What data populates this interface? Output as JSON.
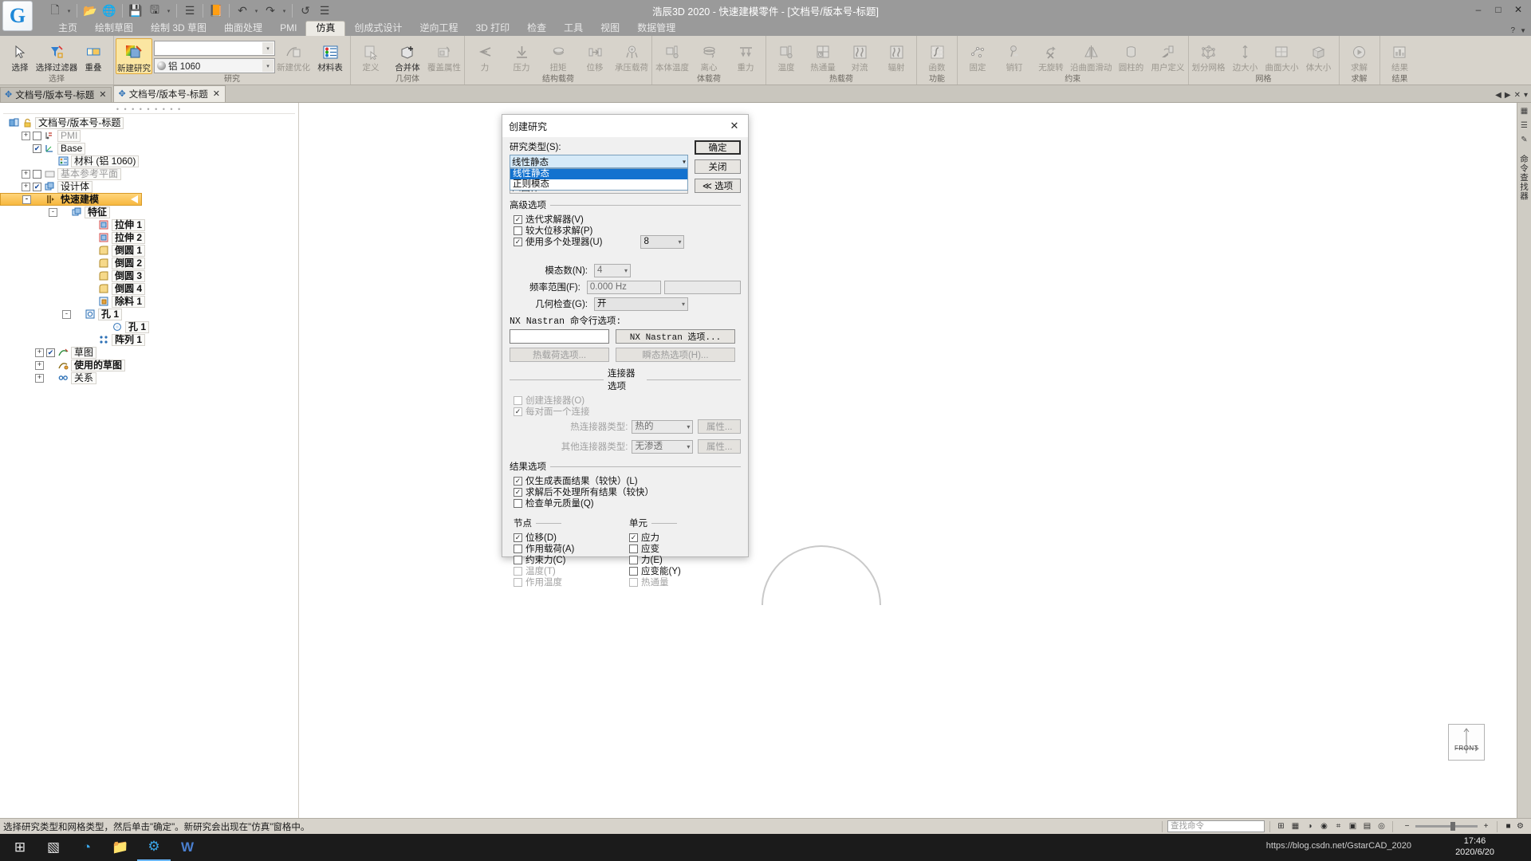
{
  "window": {
    "title": "浩辰3D 2020 - 快速建模零件 - [文档号/版本号-标题]",
    "logo_text": "G",
    "minimize": "–",
    "maximize": "□",
    "close": "✕",
    "help": "?",
    "ribbon_collapse": "▼"
  },
  "quick_access": [
    {
      "name": "new-file-icon",
      "glyph": "🗋"
    },
    {
      "name": "new-dropdown-icon",
      "glyph": "▾"
    },
    {
      "name": "open-icon",
      "glyph": "📂"
    },
    {
      "name": "web-icon",
      "glyph": "🌐"
    },
    {
      "name": "save-icon",
      "glyph": "💾"
    },
    {
      "name": "save-as-icon",
      "glyph": "🖫"
    },
    {
      "name": "save-dropdown-icon",
      "glyph": "▾"
    },
    {
      "name": "properties-icon",
      "glyph": "☰"
    },
    {
      "name": "print-icon",
      "glyph": "📙"
    },
    {
      "name": "undo-icon",
      "glyph": "↶"
    },
    {
      "name": "undo-dropdown-icon",
      "glyph": "▾"
    },
    {
      "name": "redo-icon",
      "glyph": "↷"
    },
    {
      "name": "redo-dropdown-icon",
      "glyph": "▾"
    },
    {
      "name": "repeat-icon",
      "glyph": "↺"
    },
    {
      "name": "customize-icon",
      "glyph": "☰"
    }
  ],
  "tabs": [
    {
      "label": "主页",
      "active": false
    },
    {
      "label": "绘制草图",
      "active": false
    },
    {
      "label": "绘制 3D 草图",
      "active": false
    },
    {
      "label": "曲面处理",
      "active": false
    },
    {
      "label": "PMI",
      "active": false
    },
    {
      "label": "仿真",
      "active": true
    },
    {
      "label": "创成式设计",
      "active": false
    },
    {
      "label": "逆向工程",
      "active": false
    },
    {
      "label": "3D 打印",
      "active": false
    },
    {
      "label": "检查",
      "active": false
    },
    {
      "label": "工具",
      "active": false
    },
    {
      "label": "视图",
      "active": false
    },
    {
      "label": "数据管理",
      "active": false
    }
  ],
  "ribbon_groups": [
    {
      "name": "选择",
      "items": [
        {
          "label": "选择",
          "glyph": "↖",
          "dim": false,
          "highlight": false
        },
        {
          "label": "选择过滤器",
          "glyph": "▽",
          "dim": false,
          "highlight": false
        },
        {
          "label": "重叠",
          "glyph": "▣",
          "dim": false,
          "highlight": false
        }
      ]
    },
    {
      "name": "研究",
      "items": [
        {
          "label": "新建研究",
          "glyph": "🎨",
          "dim": false,
          "highlight": true
        },
        {
          "label": "新建优化",
          "glyph": "🖼",
          "dim": true,
          "highlight": false
        },
        {
          "label": "材料表",
          "glyph": "☰",
          "dim": false,
          "highlight": false
        }
      ],
      "combo_empty_value": "",
      "combo_material_value": "铝 1060"
    },
    {
      "name": "几何体",
      "items": [
        {
          "label": "定义",
          "glyph": "▭",
          "dim": true,
          "highlight": false
        },
        {
          "label": "合并体",
          "glyph": "❐",
          "dim": false,
          "highlight": false
        },
        {
          "label": "覆盖属性",
          "glyph": "✋",
          "dim": true,
          "highlight": false
        }
      ]
    },
    {
      "name": "结构载荷",
      "items": [
        {
          "label": "力",
          "glyph": "⇐",
          "dim": true,
          "highlight": false
        },
        {
          "label": "压力",
          "glyph": "⬇",
          "dim": true,
          "highlight": false
        },
        {
          "label": "扭矩",
          "glyph": "↺",
          "dim": true,
          "highlight": false
        },
        {
          "label": "位移",
          "glyph": "↦",
          "dim": true,
          "highlight": false
        },
        {
          "label": "承压载荷",
          "glyph": "❂",
          "dim": true,
          "highlight": false
        }
      ]
    },
    {
      "name": "体载荷",
      "items": [
        {
          "label": "本体温度",
          "glyph": "🌡",
          "dim": true,
          "highlight": false
        },
        {
          "label": "离心",
          "glyph": "⟳",
          "dim": true,
          "highlight": false
        },
        {
          "label": "重力",
          "glyph": "⇊",
          "dim": true,
          "highlight": false
        }
      ]
    },
    {
      "name": "热载荷",
      "items": [
        {
          "label": "温度",
          "glyph": "🌡",
          "dim": true,
          "highlight": false
        },
        {
          "label": "热通量",
          "glyph": "⊞",
          "dim": true,
          "highlight": false
        },
        {
          "label": "对流",
          "glyph": "≈",
          "dim": true,
          "highlight": false
        },
        {
          "label": "辐射",
          "glyph": "✳",
          "dim": true,
          "highlight": false
        }
      ]
    },
    {
      "name": "功能",
      "items": [
        {
          "label": "函数",
          "glyph": "ƒ",
          "dim": true,
          "highlight": false
        }
      ]
    },
    {
      "name": "约束",
      "items": [
        {
          "label": "固定",
          "glyph": "✦",
          "dim": true,
          "highlight": false
        },
        {
          "label": "销钉",
          "glyph": "📍",
          "dim": true,
          "highlight": false
        },
        {
          "label": "无旋转",
          "glyph": "↷",
          "dim": true,
          "highlight": false
        },
        {
          "label": "沿曲面滑动",
          "glyph": "△",
          "dim": true,
          "highlight": false
        },
        {
          "label": "圆柱的",
          "glyph": "▭",
          "dim": true,
          "highlight": false
        },
        {
          "label": "用户定义",
          "glyph": "☚",
          "dim": true,
          "highlight": false
        }
      ]
    },
    {
      "name": "网格",
      "items": [
        {
          "label": "划分网格",
          "glyph": "⌗",
          "dim": true,
          "highlight": false
        },
        {
          "label": "边大小",
          "glyph": "↕",
          "dim": true,
          "highlight": false
        },
        {
          "label": "曲面大小",
          "glyph": "▧",
          "dim": true,
          "highlight": false
        },
        {
          "label": "体大小",
          "glyph": "▦",
          "dim": true,
          "highlight": false
        }
      ]
    },
    {
      "name": "求解",
      "items": [
        {
          "label": "求解",
          "glyph": "▶",
          "dim": true,
          "highlight": false
        }
      ]
    },
    {
      "name": "结果",
      "items": [
        {
          "label": "结果",
          "glyph": "📊",
          "dim": true,
          "highlight": false
        }
      ]
    }
  ],
  "doc_tabs": [
    {
      "label": "文档号/版本号-标题",
      "active": false,
      "close": "✕"
    },
    {
      "label": "文档号/版本号-标题",
      "active": true,
      "close": "✕"
    }
  ],
  "doc_tabs_right": [
    "◀",
    "▶",
    "✕",
    "▾"
  ],
  "tree": {
    "root": "文档号/版本号-标题",
    "nodes": [
      {
        "label": "PMI",
        "indent": 1,
        "expander": "+",
        "checkbox": "unchecked",
        "icon": "pmi-icon",
        "dim": true,
        "boxed": true,
        "bold": false
      },
      {
        "label": "Base",
        "indent": 1,
        "expander": "none",
        "checkbox": "checked",
        "icon": "coordinate-system-icon",
        "dim": false,
        "boxed": true,
        "bold": false
      },
      {
        "label": "材料 (铝 1060)",
        "indent": 2,
        "expander": "none",
        "checkbox": "none",
        "icon": "material-icon",
        "dim": false,
        "boxed": true,
        "bold": false
      },
      {
        "label": "基本参考平面",
        "indent": 1,
        "expander": "+",
        "checkbox": "unchecked",
        "icon": "plane-icon",
        "dim": true,
        "boxed": true,
        "bold": false
      },
      {
        "label": "设计体",
        "indent": 1,
        "expander": "+",
        "checkbox": "checked",
        "icon": "body-icon",
        "dim": false,
        "boxed": true,
        "bold": false
      },
      {
        "label": "快速建模",
        "indent": 1,
        "expander": "-",
        "checkbox": "none",
        "icon": "quickmodel-icon",
        "dim": false,
        "boxed": false,
        "bold": true,
        "selected": true
      },
      {
        "label": "特征",
        "indent": 3,
        "expander": "-",
        "checkbox": "none",
        "icon": "feature-icon",
        "dim": false,
        "boxed": true,
        "bold": true
      },
      {
        "label": "拉伸 1",
        "indent": 5,
        "expander": "none",
        "checkbox": "none",
        "icon": "extrude-icon",
        "dim": false,
        "boxed": true,
        "bold": true
      },
      {
        "label": "拉伸 2",
        "indent": 5,
        "expander": "none",
        "checkbox": "none",
        "icon": "extrude-icon",
        "dim": false,
        "boxed": true,
        "bold": true
      },
      {
        "label": "倒圆 1",
        "indent": 5,
        "expander": "none",
        "checkbox": "none",
        "icon": "fillet-icon",
        "dim": false,
        "boxed": true,
        "bold": true
      },
      {
        "label": "倒圆 2",
        "indent": 5,
        "expander": "none",
        "checkbox": "none",
        "icon": "fillet-icon",
        "dim": false,
        "boxed": true,
        "bold": true
      },
      {
        "label": "倒圆 3",
        "indent": 5,
        "expander": "none",
        "checkbox": "none",
        "icon": "fillet-icon",
        "dim": false,
        "boxed": true,
        "bold": true
      },
      {
        "label": "倒圆 4",
        "indent": 5,
        "expander": "none",
        "checkbox": "none",
        "icon": "fillet-icon",
        "dim": false,
        "boxed": true,
        "bold": true
      },
      {
        "label": "除料 1",
        "indent": 5,
        "expander": "none",
        "checkbox": "none",
        "icon": "cut-icon",
        "dim": false,
        "boxed": true,
        "bold": true
      },
      {
        "label": "孔 1",
        "indent": 4,
        "expander": "-",
        "checkbox": "none",
        "icon": "hole-group-icon",
        "dim": false,
        "boxed": true,
        "bold": true
      },
      {
        "label": "孔 1",
        "indent": 6,
        "expander": "none",
        "checkbox": "none",
        "icon": "hole-icon",
        "dim": false,
        "boxed": true,
        "bold": true
      },
      {
        "label": "阵列 1",
        "indent": 5,
        "expander": "none",
        "checkbox": "none",
        "icon": "pattern-icon",
        "dim": false,
        "boxed": true,
        "bold": true
      },
      {
        "label": "草图",
        "indent": 2,
        "expander": "+",
        "checkbox": "checked",
        "icon": "sketch-icon",
        "dim": false,
        "boxed": true,
        "bold": false
      },
      {
        "label": "使用的草图",
        "indent": 2,
        "expander": "+",
        "checkbox": "none",
        "icon": "used-sketch-icon",
        "dim": false,
        "boxed": true,
        "bold": true
      },
      {
        "label": "关系",
        "indent": 2,
        "expander": "+",
        "checkbox": "none",
        "icon": "relations-icon",
        "dim": false,
        "boxed": true,
        "bold": false
      }
    ]
  },
  "viewcube": {
    "label": "FRONT"
  },
  "right_dock": {
    "icons": [
      "▦",
      "☰",
      "✎"
    ],
    "vertical_text": "命令查找器"
  },
  "dialog": {
    "title": "创建研究",
    "close": "✕",
    "study_type_label": "研究类型(S):",
    "study_type_value": "线性静态",
    "study_type_options": [
      {
        "label": "线性静态",
        "selected": true
      },
      {
        "label": "正则模态",
        "selected": false
      }
    ],
    "mesh_type_value": "四面体",
    "buttons": {
      "ok": "确定",
      "close": "关闭",
      "options": "≪ 选项"
    },
    "advanced_section": "高级选项",
    "advanced_checks": [
      {
        "label": "迭代求解器(V)",
        "checked": true,
        "disabled": false
      },
      {
        "label": "较大位移求解(P)",
        "checked": false,
        "disabled": false
      },
      {
        "label": "使用多个处理器(U)",
        "checked": true,
        "disabled": false
      }
    ],
    "processor_count": "8",
    "fields": [
      {
        "label": "模态数(N):",
        "value": "4",
        "type": "spin",
        "disabled": true
      },
      {
        "label": "频率范围(F):",
        "value": "0.000 Hz",
        "type": "text",
        "disabled": true
      },
      {
        "label": "几何检查(G):",
        "value": "开",
        "type": "combo",
        "disabled": false
      }
    ],
    "nastran_label": "NX Nastran 命令行选项:",
    "nastran_value": "",
    "thermal_load_button": "热载荷选项...",
    "transient_thermal_button": "瞬态热选项(H)...",
    "connector_section": "连接器选项",
    "connector_checks": [
      {
        "label": "创建连接器(O)",
        "checked": false,
        "disabled": true
      },
      {
        "label": "每对面一个连接",
        "checked": true,
        "disabled": true
      }
    ],
    "thermal_connector_label": "热连接器类型:",
    "thermal_connector_value": "热的",
    "thermal_connector_prop": "属性...",
    "other_connector_label": "其他连接器类型:",
    "other_connector_value": "无渗透",
    "other_connector_prop": "属性...",
    "results_section": "结果选项",
    "results_checks": [
      {
        "label": "仅生成表面结果（较快）(L)",
        "checked": true,
        "disabled": false
      },
      {
        "label": "求解后不处理所有结果（较快）",
        "checked": true,
        "disabled": false
      },
      {
        "label": "检查单元质量(Q)",
        "checked": false,
        "disabled": false
      }
    ],
    "node_section": "节点",
    "node_checks": [
      {
        "label": "位移(D)",
        "checked": true,
        "disabled": false
      },
      {
        "label": "作用载荷(A)",
        "checked": false,
        "disabled": false
      },
      {
        "label": "约束力(C)",
        "checked": false,
        "disabled": false
      },
      {
        "label": "温度(T)",
        "checked": false,
        "disabled": true
      },
      {
        "label": "作用温度",
        "checked": false,
        "disabled": true
      }
    ],
    "element_section": "单元",
    "element_checks": [
      {
        "label": "应力",
        "checked": true,
        "disabled": false
      },
      {
        "label": "应变",
        "checked": false,
        "disabled": false
      },
      {
        "label": "力(E)",
        "checked": false,
        "disabled": false
      },
      {
        "label": "应变能(Y)",
        "checked": false,
        "disabled": false
      },
      {
        "label": "热通量",
        "checked": false,
        "disabled": true
      }
    ]
  },
  "statusbar": {
    "hint": "选择研究类型和网格类型，然后单击\"确定\"。新研究会出现在\"仿真\"窗格中。",
    "search_placeholder": "查找命令",
    "icons": [
      "⊞",
      "▦",
      "◑",
      "◉",
      "⌗",
      "▣",
      "▤",
      "◎"
    ],
    "zoom_minus": "−",
    "zoom_plus": "+",
    "right_icons": [
      "■",
      "⚙"
    ]
  },
  "taskbar": {
    "start": "⊞",
    "icons": [
      {
        "name": "task-view-icon",
        "glyph": "▧"
      },
      {
        "name": "edge-icon",
        "glyph": "◔"
      },
      {
        "name": "file-explorer-icon",
        "glyph": "📁"
      },
      {
        "name": "gstarcad-icon",
        "glyph": "⚙"
      },
      {
        "name": "wps-icon",
        "glyph": "W"
      }
    ],
    "time": "17:46",
    "date": "2020/6/20",
    "url": "https://blog.csdn.net/GstarCAD_2020"
  }
}
